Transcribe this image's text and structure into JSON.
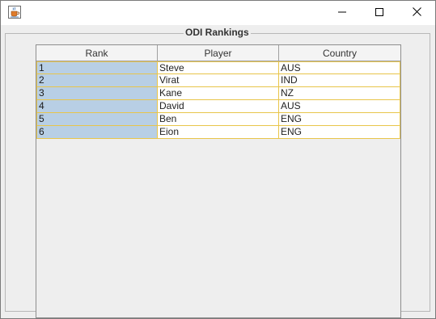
{
  "window": {
    "icon": "java-coffee-cup-icon",
    "controls": {
      "minimize_icon": "minimize-icon",
      "maximize_icon": "maximize-icon",
      "close_icon": "close-icon"
    }
  },
  "panel": {
    "border_title": "ODI Rankings"
  },
  "table": {
    "columns": [
      "Rank",
      "Player",
      "Country"
    ],
    "rows": [
      {
        "rank": "1",
        "player": "Steve",
        "country": "AUS"
      },
      {
        "rank": "2",
        "player": "Virat",
        "country": "IND"
      },
      {
        "rank": "3",
        "player": "Kane",
        "country": "NZ"
      },
      {
        "rank": "4",
        "player": "David",
        "country": "AUS"
      },
      {
        "rank": "5",
        "player": "Ben",
        "country": "ENG"
      },
      {
        "rank": "6",
        "player": "Eion",
        "country": "ENG"
      }
    ]
  },
  "colors": {
    "rank_cell_background": "#b8cfe5",
    "grid_line": "#e8c54a",
    "window_background": "#eeeeee"
  }
}
